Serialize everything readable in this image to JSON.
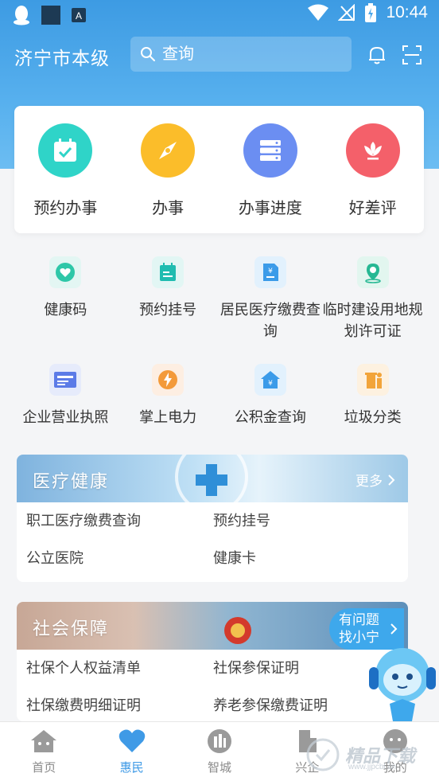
{
  "status_bar": {
    "time": "10:44"
  },
  "header": {
    "city": "济宁市本级",
    "search_placeholder": "查询"
  },
  "quick_actions": [
    {
      "label": "预约办事",
      "color": "#2fd4c8",
      "icon": "calendar-check-icon"
    },
    {
      "label": "办事",
      "color": "#fbbd2a",
      "icon": "compass-icon"
    },
    {
      "label": "办事进度",
      "color": "#6b8ef2",
      "icon": "server-list-icon"
    },
    {
      "label": "好差评",
      "color": "#f4606a",
      "icon": "lotus-icon"
    }
  ],
  "services": [
    {
      "label": "健康码",
      "icon": "health-code-icon"
    },
    {
      "label": "预约挂号",
      "icon": "register-icon"
    },
    {
      "label": "居民医疗缴费查询",
      "icon": "medical-fee-icon"
    },
    {
      "label": "临时建设用地规划许可证",
      "icon": "location-permit-icon"
    },
    {
      "label": "企业营业执照",
      "icon": "business-license-icon"
    },
    {
      "label": "掌上电力",
      "icon": "lightning-icon"
    },
    {
      "label": "公积金查询",
      "icon": "housing-fund-icon"
    },
    {
      "label": "垃圾分类",
      "icon": "trash-sort-icon"
    }
  ],
  "medical_panel": {
    "title": "医疗健康",
    "more": "更多",
    "links": [
      "职工医疗缴费查询",
      "预约挂号",
      "公立医院",
      "健康卡"
    ]
  },
  "social_panel": {
    "title": "社会保障",
    "help_line1": "有问题",
    "help_line2": "找小宁",
    "links": [
      "社保个人权益清单",
      "社保参保证明",
      "社保缴费明细证明",
      "养老参保缴费证明"
    ]
  },
  "tabs": [
    {
      "label": "首页",
      "icon": "home-icon",
      "active": false
    },
    {
      "label": "惠民",
      "icon": "heart-icon",
      "active": true
    },
    {
      "label": "智城",
      "icon": "city-icon",
      "active": false
    },
    {
      "label": "兴企",
      "icon": "enterprise-icon",
      "active": false
    },
    {
      "label": "我的",
      "icon": "profile-icon",
      "active": false
    }
  ],
  "watermark": {
    "text": "精品下载",
    "sub": "www.jjpcbl.cn"
  },
  "colors": {
    "primary": "#3f9ae6",
    "header": "#4aa6ea"
  }
}
